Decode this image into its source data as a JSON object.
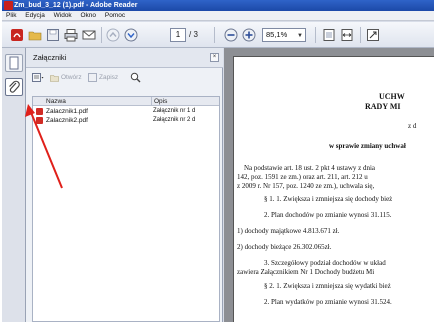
{
  "window": {
    "title": "Zm_bud_3_12 (1).pdf - Adobe Reader"
  },
  "menu": [
    "Plik",
    "Edycja",
    "Widok",
    "Okno",
    "Pomoc"
  ],
  "toolbar": {
    "page_current": "1",
    "page_count": "/ 3",
    "zoom": "85,1%"
  },
  "attachments_panel": {
    "title": "Załączniki",
    "close_label": "×",
    "tools": [
      "Otwórz",
      "Zapisz"
    ],
    "columns": [
      "Nazwa",
      "Opis"
    ],
    "rows": [
      {
        "name": "Zalacznik1.pdf",
        "desc": "Załącznik nr 1 d"
      },
      {
        "name": "Zalacznik2.pdf",
        "desc": "Załącznik nr 2 d"
      }
    ]
  },
  "document": {
    "lines": [
      "UCHW",
      "RADY MI",
      "z d",
      "w sprawie zmiany uchwał",
      "Na podstawie art. 18 ust. 2 pkt 4 ustawy z dnia",
      "142, poz. 1591 ze zm.) oraz art. 211, art. 212 u",
      "z 2009 r. Nr 157, poz. 1240 ze zm.), uchwala się,",
      "§ 1. 1. Zwiększa i zmniejsza się dochody bież",
      "2. Plan dochodów po zmianie wynosi 31.115.",
      "1) dochody majątkowe 4.813.671 zł.",
      "2) dochody bieżące 26.302.065zł.",
      "3. Szczegółowy podział dochodów w układ",
      "zawiera Załącznikiem Nr 1 Dochody budżetu Mi",
      "§ 2. 1. Zwiększa i zmniejsza się wydatki bież",
      "2. Plan wydatków po zmianie wynosi 31.524."
    ]
  },
  "colors": {
    "titlebar": "#2f63c8",
    "doc_background": "#8d8f94",
    "annotation_arrow": "#e0201a"
  }
}
